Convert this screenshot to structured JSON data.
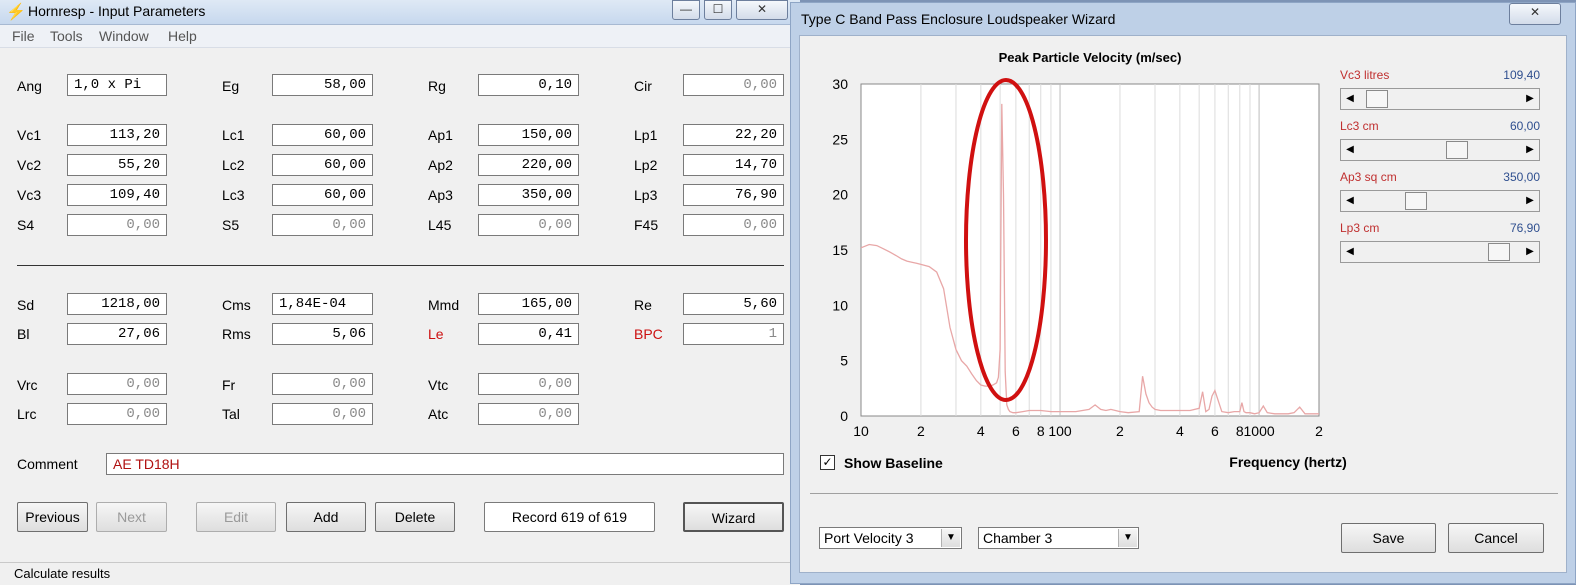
{
  "left": {
    "title": "Hornresp - Input Parameters",
    "menu": [
      "File",
      "Tools",
      "Window",
      "Help"
    ],
    "labels": {
      "ang": "Ang",
      "eg": "Eg",
      "rg": "Rg",
      "cir": "Cir",
      "vc1": "Vc1",
      "lc1": "Lc1",
      "ap1": "Ap1",
      "lp1": "Lp1",
      "vc2": "Vc2",
      "lc2": "Lc2",
      "ap2": "Ap2",
      "lp2": "Lp2",
      "vc3": "Vc3",
      "lc3": "Lc3",
      "ap3": "Ap3",
      "lp3": "Lp3",
      "s4": "S4",
      "s5": "S5",
      "l45": "L45",
      "f45": "F45",
      "sd": "Sd",
      "cms": "Cms",
      "mmd": "Mmd",
      "re": "Re",
      "bl": "Bl",
      "rms": "Rms",
      "le": "Le",
      "bpc": "BPC",
      "vrc": "Vrc",
      "fr": "Fr",
      "vtc": "Vtc",
      "lrc": "Lrc",
      "tal": "Tal",
      "atc": "Atc",
      "comment": "Comment"
    },
    "values": {
      "ang": "1,0 x Pi",
      "eg": "58,00",
      "rg": "0,10",
      "cir": "0,00",
      "vc1": "113,20",
      "lc1": "60,00",
      "ap1": "150,00",
      "lp1": "22,20",
      "vc2": "55,20",
      "lc2": "60,00",
      "ap2": "220,00",
      "lp2": "14,70",
      "vc3": "109,40",
      "lc3": "60,00",
      "ap3": "350,00",
      "lp3": "76,90",
      "s4": "0,00",
      "s5": "0,00",
      "l45": "0,00",
      "f45": "0,00",
      "sd": "1218,00",
      "cms": "1,84E-04",
      "mmd": "165,00",
      "re": "5,60",
      "bl": "27,06",
      "rms": "5,06",
      "le": "0,41",
      "bpc": "1",
      "vrc": "0,00",
      "fr": "0,00",
      "vtc": "0,00",
      "lrc": "0,00",
      "tal": "0,00",
      "atc": "0,00"
    },
    "comment": "AE TD18H",
    "buttons": {
      "previous": "Previous",
      "next": "Next",
      "edit": "Edit",
      "add": "Add",
      "delete": "Delete",
      "wizard": "Wizard"
    },
    "record": "Record 619 of 619",
    "status": "Calculate results"
  },
  "right": {
    "title": "Type C Band Pass Enclosure Loudspeaker Wizard",
    "sliders": [
      {
        "label": "Vc3  litres",
        "value": "109,40",
        "level": 0.05
      },
      {
        "label": "Lc3  cm",
        "value": "60,00",
        "level": 0.62
      },
      {
        "label": "Ap3  sq cm",
        "value": "350,00",
        "level": 0.33
      },
      {
        "label": "Lp3  cm",
        "value": "76,90",
        "level": 0.92
      }
    ],
    "show_baseline": "Show Baseline",
    "show_baseline_checked": true,
    "dropdown1": "Port Velocity 3",
    "dropdown2": "Chamber 3",
    "save": "Save",
    "cancel": "Cancel"
  },
  "chart_data": {
    "type": "line",
    "title": "Peak Particle Velocity (m/sec)",
    "xlabel": "Frequency (hertz)",
    "ylabel": "",
    "xscale": "log",
    "xlim": [
      10,
      2000
    ],
    "ylim": [
      0,
      30
    ],
    "xticks": [
      "10",
      "2",
      "4",
      "6",
      "8",
      "100",
      "2",
      "4",
      "6",
      "8",
      "1000",
      "2"
    ],
    "yticks": [
      "0",
      "5",
      "10",
      "15",
      "20",
      "25",
      "30"
    ],
    "grid": true,
    "line_color": "#e8a7a7",
    "annotation_color": "#d01010",
    "series": [
      {
        "x": [
          10,
          11,
          12,
          13,
          14,
          15,
          16,
          17,
          18,
          19,
          20,
          22,
          24,
          26,
          28,
          30,
          32,
          34,
          36,
          38,
          40,
          42,
          44,
          46,
          48,
          49,
          50,
          51,
          52,
          53,
          54,
          55,
          56,
          58,
          60,
          65,
          70,
          80,
          90,
          100,
          120,
          140,
          150,
          160,
          170,
          180,
          200,
          220,
          250,
          260,
          270,
          280,
          290,
          300,
          320,
          340,
          360,
          380,
          400,
          450,
          500,
          520,
          540,
          560,
          580,
          600,
          650,
          700,
          750,
          800,
          820,
          840,
          860,
          900,
          950,
          1000,
          1050,
          1100,
          1200,
          1400,
          1500,
          1600,
          1700,
          1800,
          2000
        ],
        "values": [
          15.2,
          15.5,
          15.4,
          15.1,
          14.8,
          14.5,
          14.2,
          14.0,
          13.9,
          13.8,
          13.7,
          13.5,
          13.0,
          11.5,
          8.0,
          6.0,
          5.0,
          4.5,
          3.8,
          3.2,
          2.8,
          2.7,
          2.7,
          2.8,
          3.0,
          3.5,
          6.0,
          28.2,
          20.0,
          4.0,
          1.0,
          0.6,
          0.4,
          0.3,
          0.3,
          0.4,
          0.5,
          0.5,
          0.4,
          0.4,
          0.4,
          0.6,
          1.0,
          0.6,
          0.5,
          0.6,
          0.4,
          0.3,
          0.4,
          3.6,
          2.0,
          1.2,
          0.8,
          0.6,
          0.5,
          0.5,
          0.5,
          0.5,
          0.5,
          0.5,
          0.7,
          2.2,
          0.4,
          0.6,
          1.8,
          2.3,
          0.4,
          0.3,
          0.4,
          0.4,
          1.2,
          0.4,
          0.3,
          0.3,
          0.2,
          0.3,
          0.9,
          0.3,
          0.2,
          0.2,
          0.3,
          0.8,
          0.2,
          0.2,
          0.2
        ]
      }
    ]
  }
}
